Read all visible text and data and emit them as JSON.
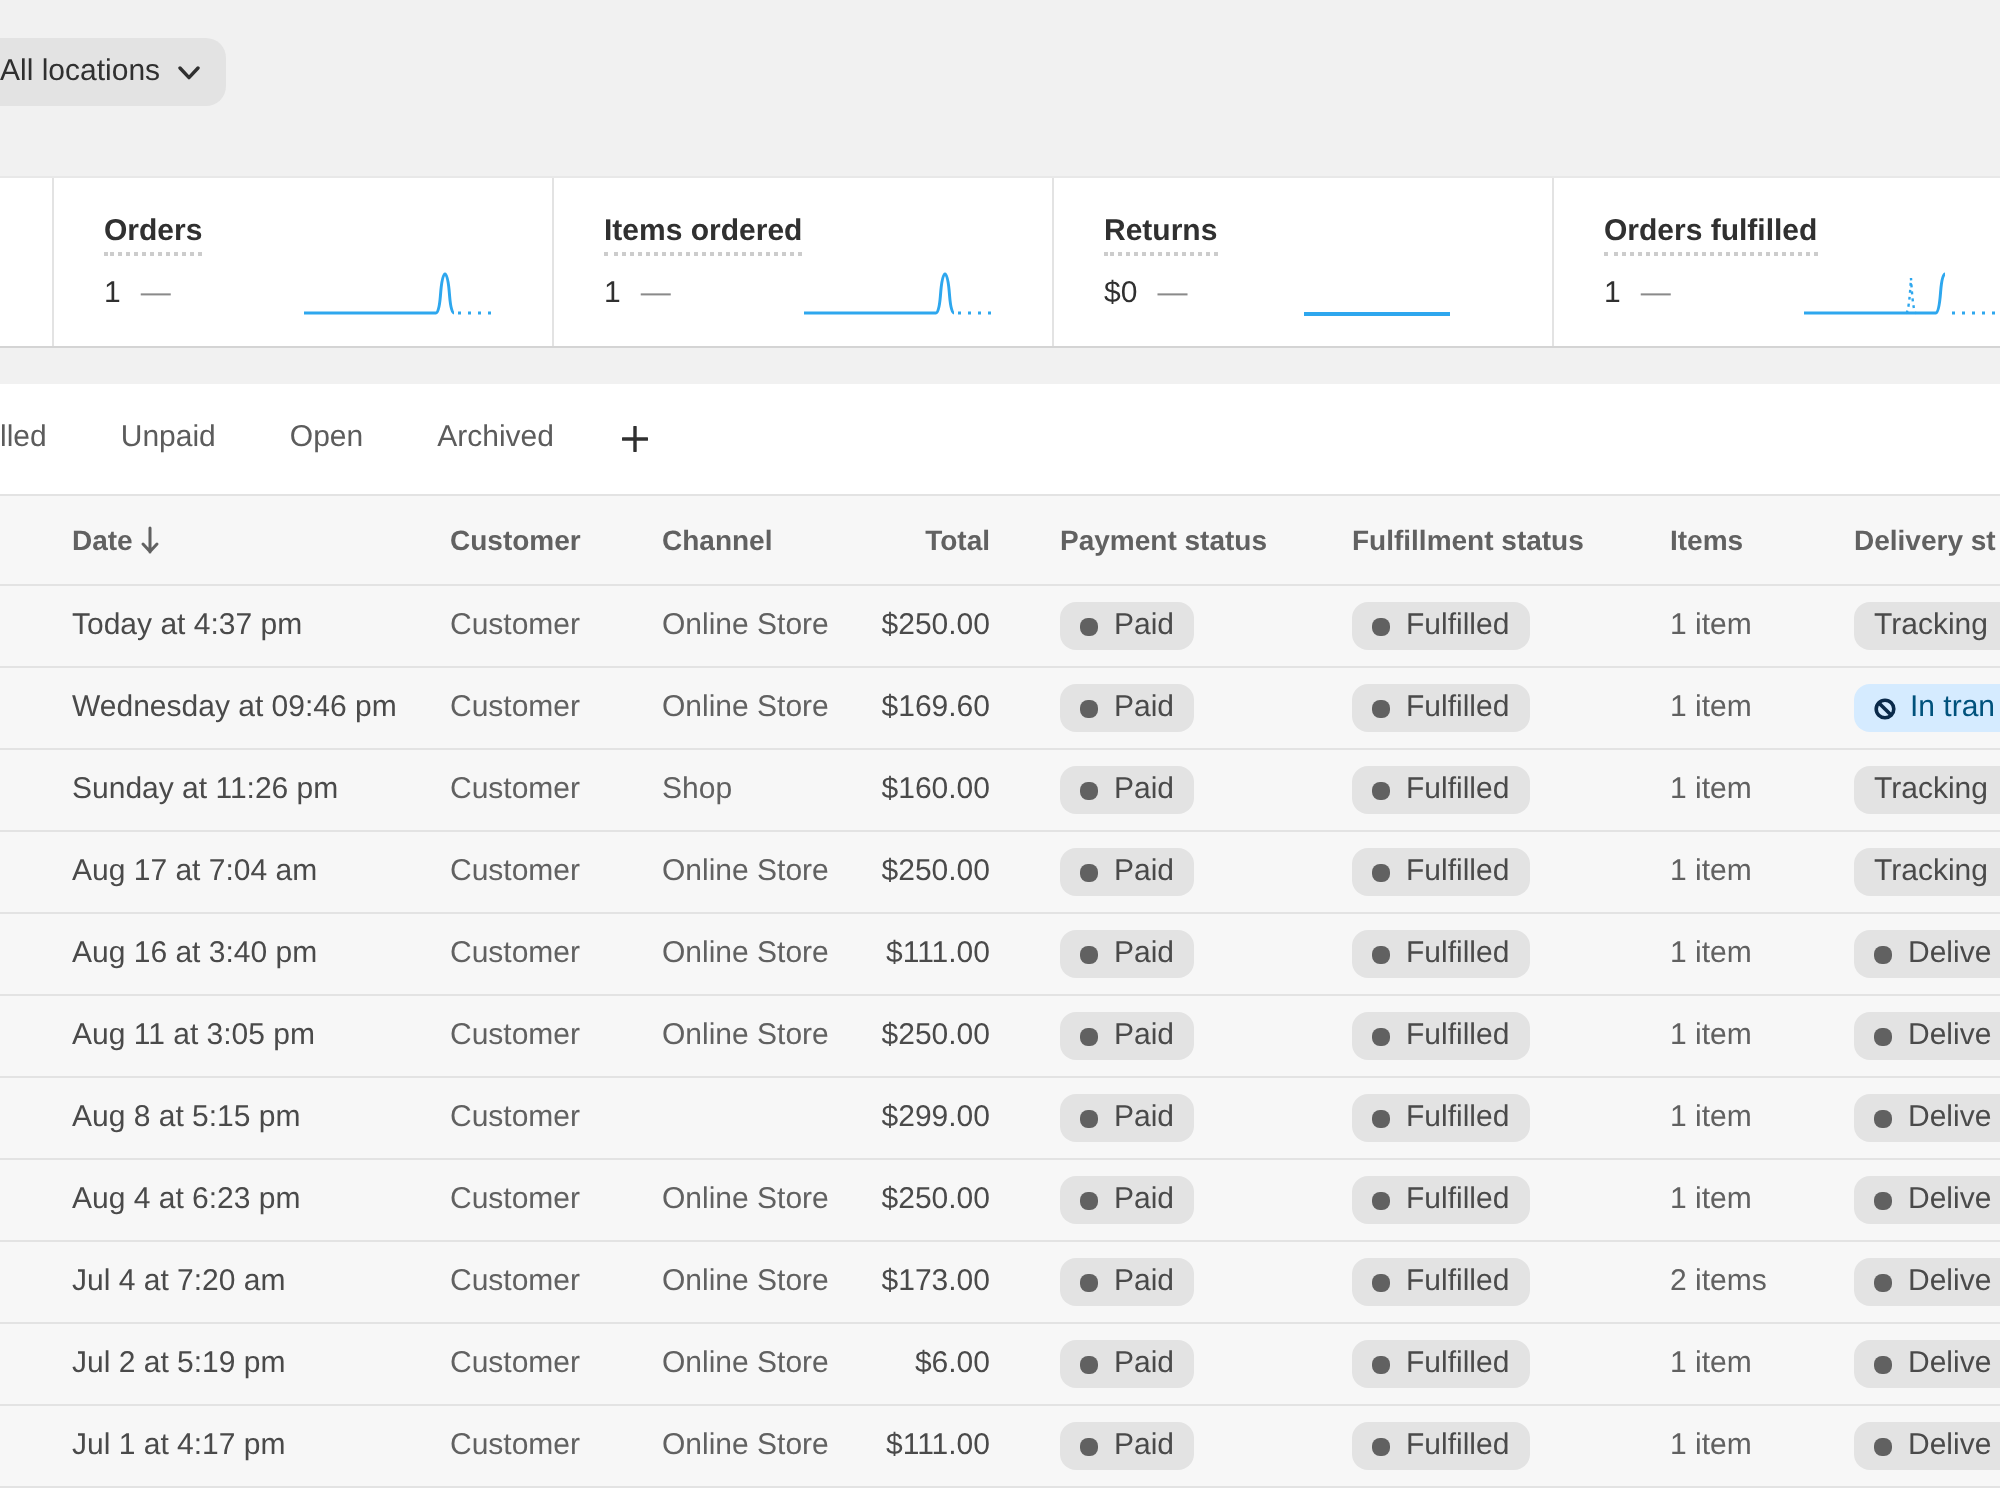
{
  "location_filter": {
    "label": "All locations"
  },
  "metrics": [
    {
      "label": "Orders",
      "value": "1",
      "change": "—",
      "kind": "spike"
    },
    {
      "label": "Items ordered",
      "value": "1",
      "change": "—",
      "kind": "spike"
    },
    {
      "label": "Returns",
      "value": "$0",
      "change": "—",
      "kind": "flat"
    },
    {
      "label": "Orders fulfilled",
      "value": "1",
      "change": "—",
      "kind": "rise"
    }
  ],
  "tabs": [
    {
      "label": "lled",
      "selected": false
    },
    {
      "label": "Unpaid",
      "selected": false
    },
    {
      "label": "Open",
      "selected": false
    },
    {
      "label": "Archived",
      "selected": false
    }
  ],
  "table": {
    "columns": [
      {
        "label": "Date",
        "sorted": true
      },
      {
        "label": "Customer",
        "sorted": false
      },
      {
        "label": "Channel",
        "sorted": false
      },
      {
        "label": "Total",
        "sorted": false
      },
      {
        "label": "Payment status",
        "sorted": false
      },
      {
        "label": "Fulfillment status",
        "sorted": false
      },
      {
        "label": "Items",
        "sorted": false
      },
      {
        "label": "Delivery st",
        "sorted": false
      }
    ],
    "rows": [
      {
        "date": "Today at 4:37 pm",
        "customer": "Customer",
        "channel": "Online Store",
        "total": "$250.00",
        "payment_status": "Paid",
        "fulfillment_status": "Fulfilled",
        "items": "1 item",
        "delivery_status": {
          "label": "Tracking",
          "kind": "plain"
        }
      },
      {
        "date": "Wednesday at 09:46 pm",
        "customer": "Customer",
        "channel": "Online Store",
        "total": "$169.60",
        "payment_status": "Paid",
        "fulfillment_status": "Fulfilled",
        "items": "1 item",
        "delivery_status": {
          "label": "In tran",
          "kind": "info"
        }
      },
      {
        "date": "Sunday at 11:26 pm",
        "customer": "Customer",
        "channel": "Shop",
        "total": "$160.00",
        "payment_status": "Paid",
        "fulfillment_status": "Fulfilled",
        "items": "1 item",
        "delivery_status": {
          "label": "Tracking",
          "kind": "plain"
        }
      },
      {
        "date": "Aug 17 at 7:04 am",
        "customer": "Customer",
        "channel": "Online Store",
        "total": "$250.00",
        "payment_status": "Paid",
        "fulfillment_status": "Fulfilled",
        "items": "1 item",
        "delivery_status": {
          "label": "Tracking",
          "kind": "plain"
        }
      },
      {
        "date": "Aug 16 at 3:40 pm",
        "customer": "Customer",
        "channel": "Online Store",
        "total": "$111.00",
        "payment_status": "Paid",
        "fulfillment_status": "Fulfilled",
        "items": "1 item",
        "delivery_status": {
          "label": "Delive",
          "kind": "dot"
        }
      },
      {
        "date": "Aug 11 at 3:05 pm",
        "customer": "Customer",
        "channel": "Online Store",
        "total": "$250.00",
        "payment_status": "Paid",
        "fulfillment_status": "Fulfilled",
        "items": "1 item",
        "delivery_status": {
          "label": "Delive",
          "kind": "dot"
        }
      },
      {
        "date": "Aug 8 at 5:15 pm",
        "customer": "Customer",
        "total": "$299.00",
        "payment_status": "Paid",
        "fulfillment_status": "Fulfilled",
        "items": "1 item",
        "delivery_status": {
          "label": "Delive",
          "kind": "dot"
        }
      },
      {
        "date": "Aug 4 at 6:23 pm",
        "customer": "Customer",
        "channel": "Online Store",
        "total": "$250.00",
        "payment_status": "Paid",
        "fulfillment_status": "Fulfilled",
        "items": "1 item",
        "delivery_status": {
          "label": "Delive",
          "kind": "dot"
        }
      },
      {
        "date": "Jul 4 at 7:20 am",
        "customer": "Customer",
        "channel": "Online Store",
        "total": "$173.00",
        "payment_status": "Paid",
        "fulfillment_status": "Fulfilled",
        "items": "2 items",
        "delivery_status": {
          "label": "Delive",
          "kind": "dot"
        }
      },
      {
        "date": "Jul 2 at 5:19 pm",
        "customer": "Customer",
        "channel": "Online Store",
        "total": "$6.00",
        "payment_status": "Paid",
        "fulfillment_status": "Fulfilled",
        "items": "1 item",
        "delivery_status": {
          "label": "Delive",
          "kind": "dot"
        }
      },
      {
        "date": "Jul 1 at 4:17 pm",
        "customer": "Customer",
        "channel": "Online Store",
        "total": "$111.00",
        "payment_status": "Paid",
        "fulfillment_status": "Fulfilled",
        "items": "1 item",
        "delivery_status": {
          "label": "Delive",
          "kind": "dot"
        }
      }
    ]
  }
}
